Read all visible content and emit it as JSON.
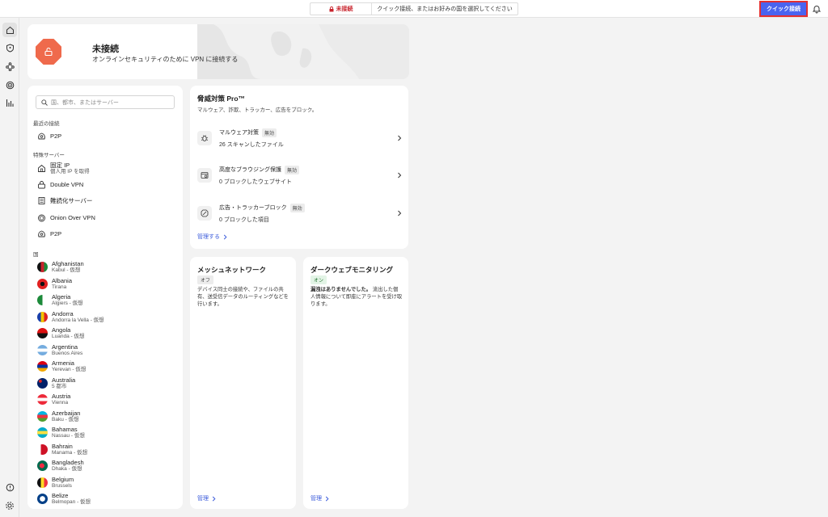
{
  "topbar": {
    "status": "未接続",
    "hint": "クイック接続、またはお好みの国を選択してください",
    "quick_connect": "クイック接続"
  },
  "rail": {
    "items": [
      "home-icon",
      "shield-icon",
      "mesh-icon",
      "target-icon",
      "chart-icon"
    ],
    "bottom": [
      "help-icon",
      "gear-icon"
    ]
  },
  "hero": {
    "title": "未接続",
    "subtitle": "オンラインセキュリティのために VPN に接続する"
  },
  "search": {
    "placeholder": "国、都市、またはサーバー"
  },
  "recent": {
    "label": "最近の接続",
    "items": [
      {
        "name": "P2P"
      }
    ]
  },
  "special": {
    "label": "特殊サーバー",
    "items": [
      {
        "name": "固定 IP",
        "sub": "個人用 IP を取得"
      },
      {
        "name": "Double VPN"
      },
      {
        "name": "難読化サーバー"
      },
      {
        "name": "Onion Over VPN"
      },
      {
        "name": "P2P"
      }
    ]
  },
  "countries": {
    "label": "国",
    "items": [
      {
        "name": "Afghanistan",
        "sub": "Kabul - 仮想"
      },
      {
        "name": "Albania",
        "sub": "Tirana"
      },
      {
        "name": "Algeria",
        "sub": "Algiers - 仮想"
      },
      {
        "name": "Andorra",
        "sub": "Andorra la Vella - 仮想"
      },
      {
        "name": "Angola",
        "sub": "Luanda - 仮想"
      },
      {
        "name": "Argentina",
        "sub": "Buenos Aires"
      },
      {
        "name": "Armenia",
        "sub": "Yerevan - 仮想"
      },
      {
        "name": "Australia",
        "sub": "5 都市"
      },
      {
        "name": "Austria",
        "sub": "Vienna"
      },
      {
        "name": "Azerbaijan",
        "sub": "Baku - 仮想"
      },
      {
        "name": "Bahamas",
        "sub": "Nassau - 仮想"
      },
      {
        "name": "Bahrain",
        "sub": "Manama - 仮想"
      },
      {
        "name": "Bangladesh",
        "sub": "Dhaka - 仮想"
      },
      {
        "name": "Belgium",
        "sub": "Brussels"
      },
      {
        "name": "Belize",
        "sub": "Belmopan - 仮想"
      }
    ]
  },
  "threat": {
    "title": "脅威対策 Pro™",
    "subtitle": "マルウェア、詐欺、トラッカー、広告をブロック。",
    "features": [
      {
        "name": "マルウェア対策",
        "badge": "無効",
        "desc": "26 スキャンしたファイル"
      },
      {
        "name": "高度なブラウジング保護",
        "badge": "無効",
        "desc": "0 ブロックしたウェブサイト"
      },
      {
        "name": "広告・トラッカーブロック",
        "badge": "無効",
        "desc": "0 ブロックした項目"
      }
    ],
    "manage": "管理する"
  },
  "mesh": {
    "title": "メッシュネットワーク",
    "status": "オフ",
    "desc": "デバイス同士の接続や、ファイルの共有、送受信データのルーティングなどを行います。",
    "manage": "管理"
  },
  "darkweb": {
    "title": "ダークウェブモニタリング",
    "status": "オン",
    "desc_bold": "漏洩はありませんでした。",
    "desc": "流出した個人情報について即座にアラートを受け取ります。",
    "manage": "管理"
  },
  "colors": {
    "accent": "#4a63f0",
    "danger": "#c8232c",
    "hero_badge": "#ef6a4c",
    "link": "#3b5bdb"
  }
}
